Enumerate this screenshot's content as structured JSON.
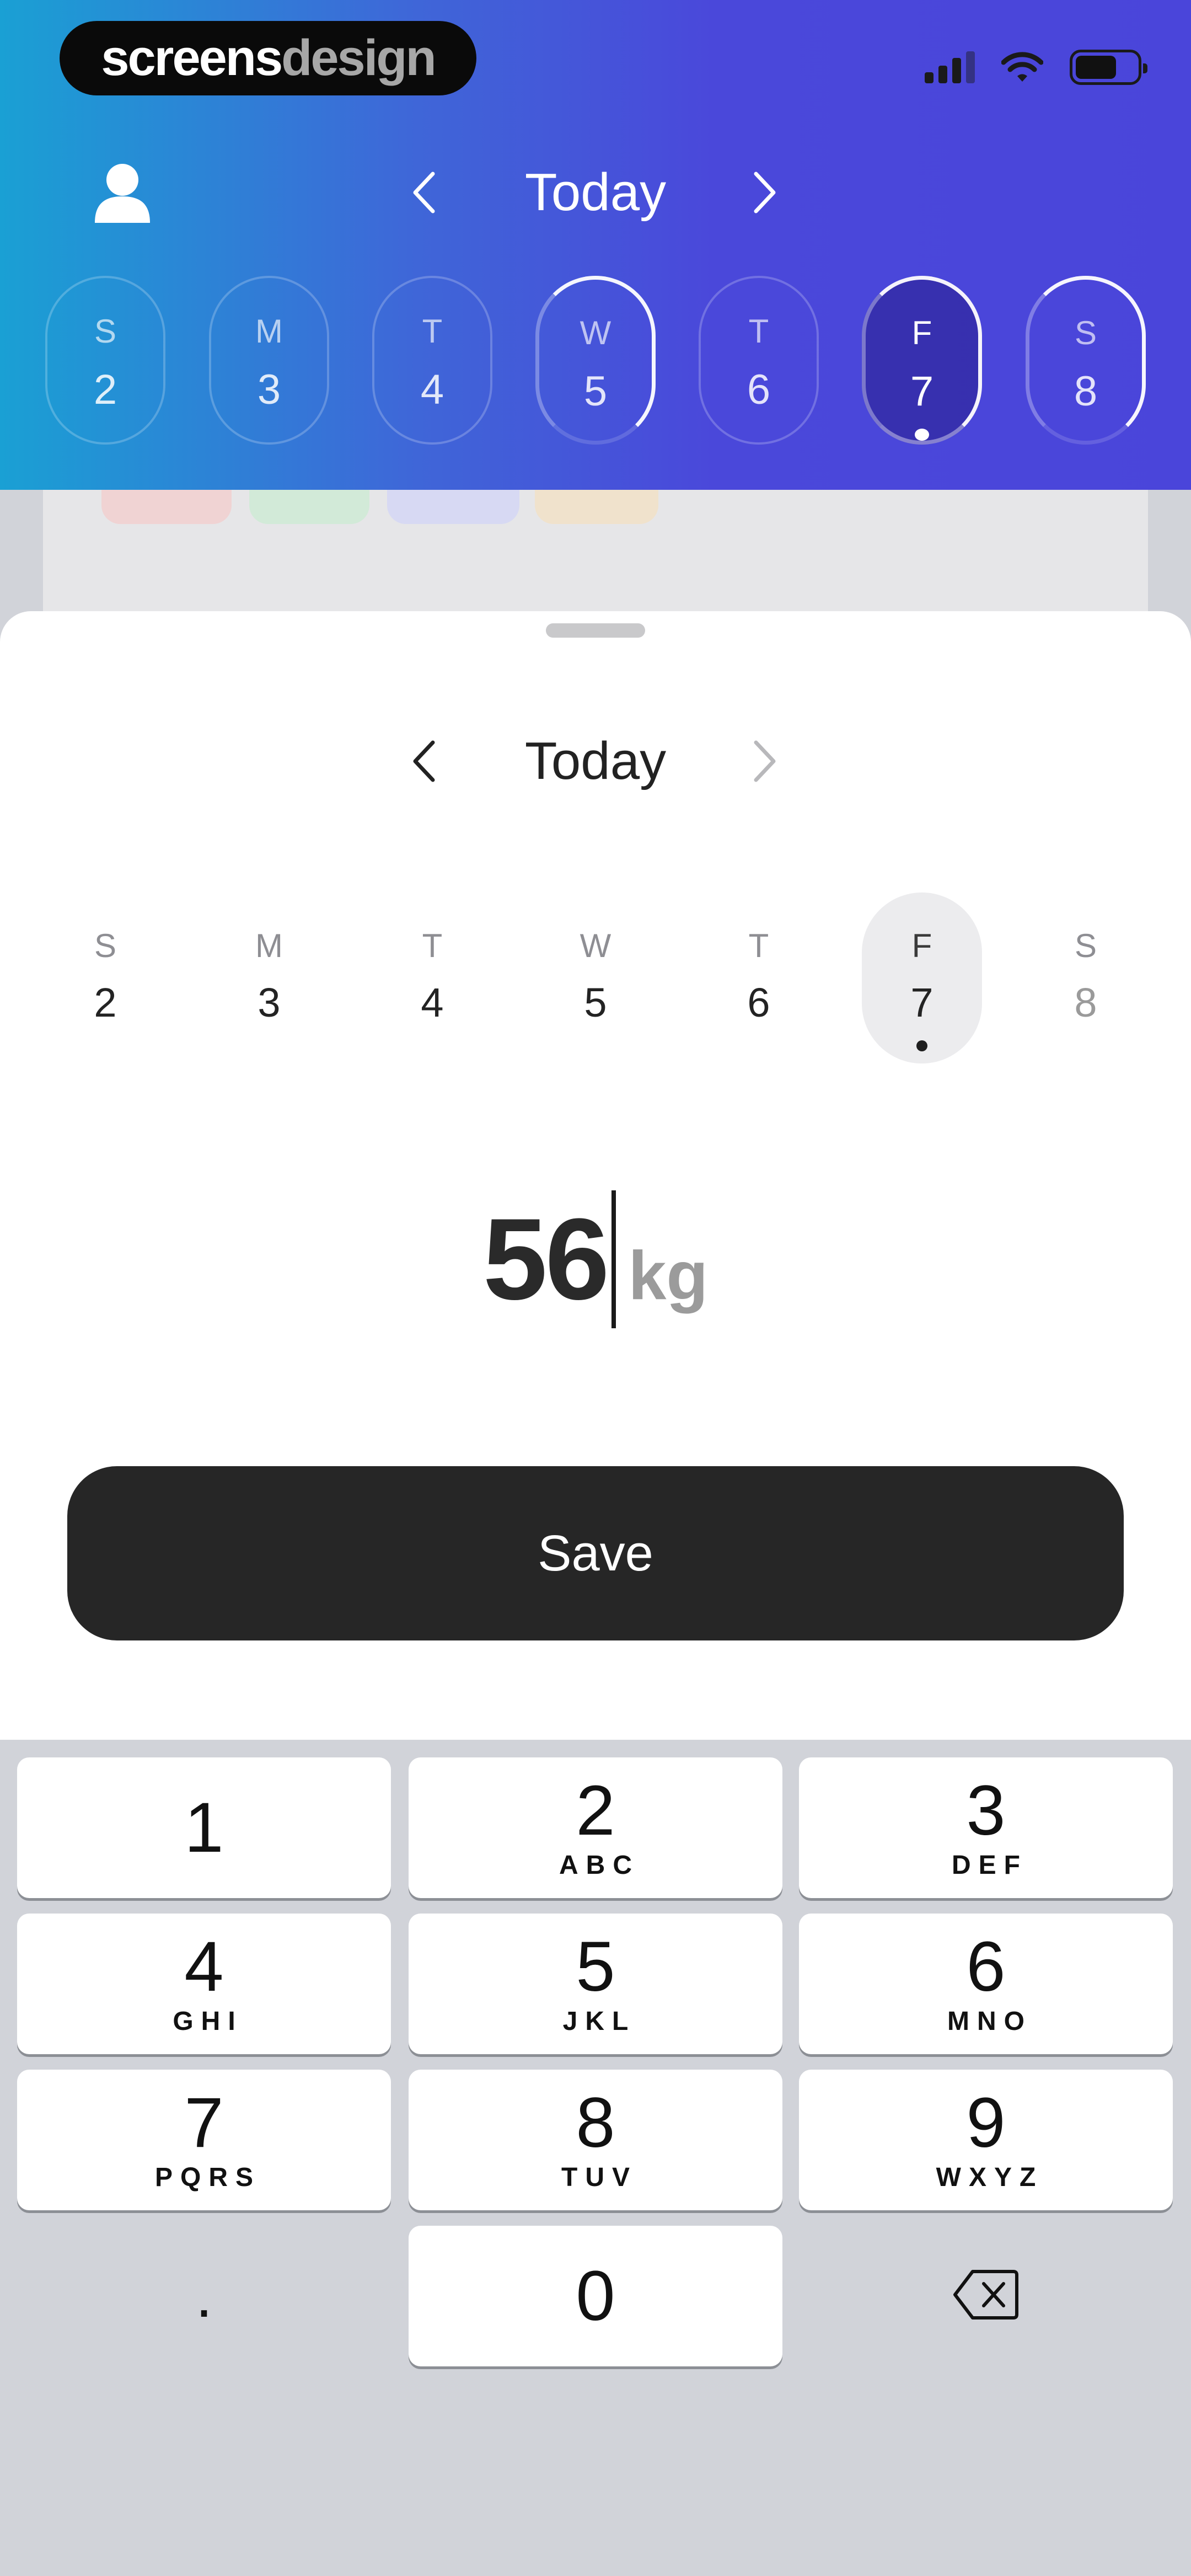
{
  "brand": {
    "part1": "screens",
    "part2": "design"
  },
  "header": {
    "title": "Today",
    "week": [
      {
        "letter": "S",
        "num": "2"
      },
      {
        "letter": "M",
        "num": "3"
      },
      {
        "letter": "T",
        "num": "4"
      },
      {
        "letter": "W",
        "num": "5"
      },
      {
        "letter": "T",
        "num": "6"
      },
      {
        "letter": "F",
        "num": "7"
      },
      {
        "letter": "S",
        "num": "8"
      }
    ]
  },
  "sheet": {
    "title": "Today",
    "week": [
      {
        "letter": "S",
        "num": "2"
      },
      {
        "letter": "M",
        "num": "3"
      },
      {
        "letter": "T",
        "num": "4"
      },
      {
        "letter": "W",
        "num": "5"
      },
      {
        "letter": "T",
        "num": "6"
      },
      {
        "letter": "F",
        "num": "7"
      },
      {
        "letter": "S",
        "num": "8"
      }
    ],
    "weight_value": "56",
    "weight_unit": "kg",
    "save_label": "Save"
  },
  "keyboard": {
    "keys": [
      {
        "num": "1",
        "letters": ""
      },
      {
        "num": "2",
        "letters": "ABC"
      },
      {
        "num": "3",
        "letters": "DEF"
      },
      {
        "num": "4",
        "letters": "GHI"
      },
      {
        "num": "5",
        "letters": "JKL"
      },
      {
        "num": "6",
        "letters": "MNO"
      },
      {
        "num": "7",
        "letters": "PQRS"
      },
      {
        "num": "8",
        "letters": "TUV"
      },
      {
        "num": "9",
        "letters": "WXYZ"
      },
      {
        "num": ".",
        "letters": ""
      },
      {
        "num": "0",
        "letters": ""
      }
    ]
  },
  "colors": {
    "header_gradient_start": "#1aa0d4",
    "header_gradient_end": "#4a45da",
    "save_button": "#262626",
    "keyboard_bg": "#d1d3d9"
  }
}
